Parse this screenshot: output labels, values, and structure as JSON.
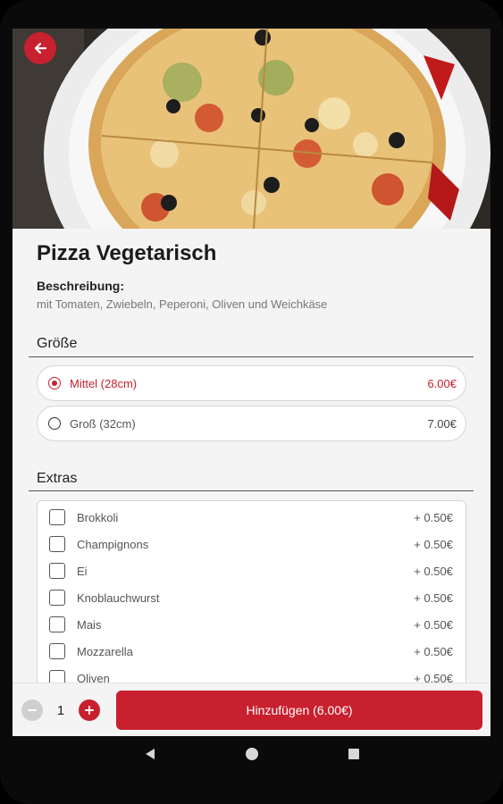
{
  "product": {
    "name": "Pizza Vegetarisch",
    "description_label": "Beschreibung:",
    "description": "mit Tomaten, Zwiebeln, Peperoni, Oliven und Weichkäse"
  },
  "size_section": {
    "title": "Größe",
    "options": [
      {
        "label": "Mittel (28cm)",
        "price": "6.00€",
        "selected": true
      },
      {
        "label": "Groß (32cm)",
        "price": "7.00€",
        "selected": false
      }
    ]
  },
  "extras_section": {
    "title": "Extras",
    "items": [
      {
        "label": "Brokkoli",
        "price": "+ 0.50€"
      },
      {
        "label": "Champignons",
        "price": "+ 0.50€"
      },
      {
        "label": "Ei",
        "price": "+ 0.50€"
      },
      {
        "label": "Knoblauchwurst",
        "price": "+ 0.50€"
      },
      {
        "label": "Mais",
        "price": "+ 0.50€"
      },
      {
        "label": "Mozzarella",
        "price": "+ 0.50€"
      },
      {
        "label": "Oliven",
        "price": "+ 0.50€"
      }
    ]
  },
  "cart": {
    "quantity": "1",
    "add_button_label": "Hinzufügen (6.00€)"
  },
  "colors": {
    "accent": "#c8202f",
    "background": "#f4f4f4"
  },
  "icons": {
    "back": "arrow-left-icon",
    "minus": "minus-icon",
    "plus": "plus-icon",
    "nav_back": "triangle-back-icon",
    "nav_home": "circle-home-icon",
    "nav_recents": "square-recents-icon"
  }
}
